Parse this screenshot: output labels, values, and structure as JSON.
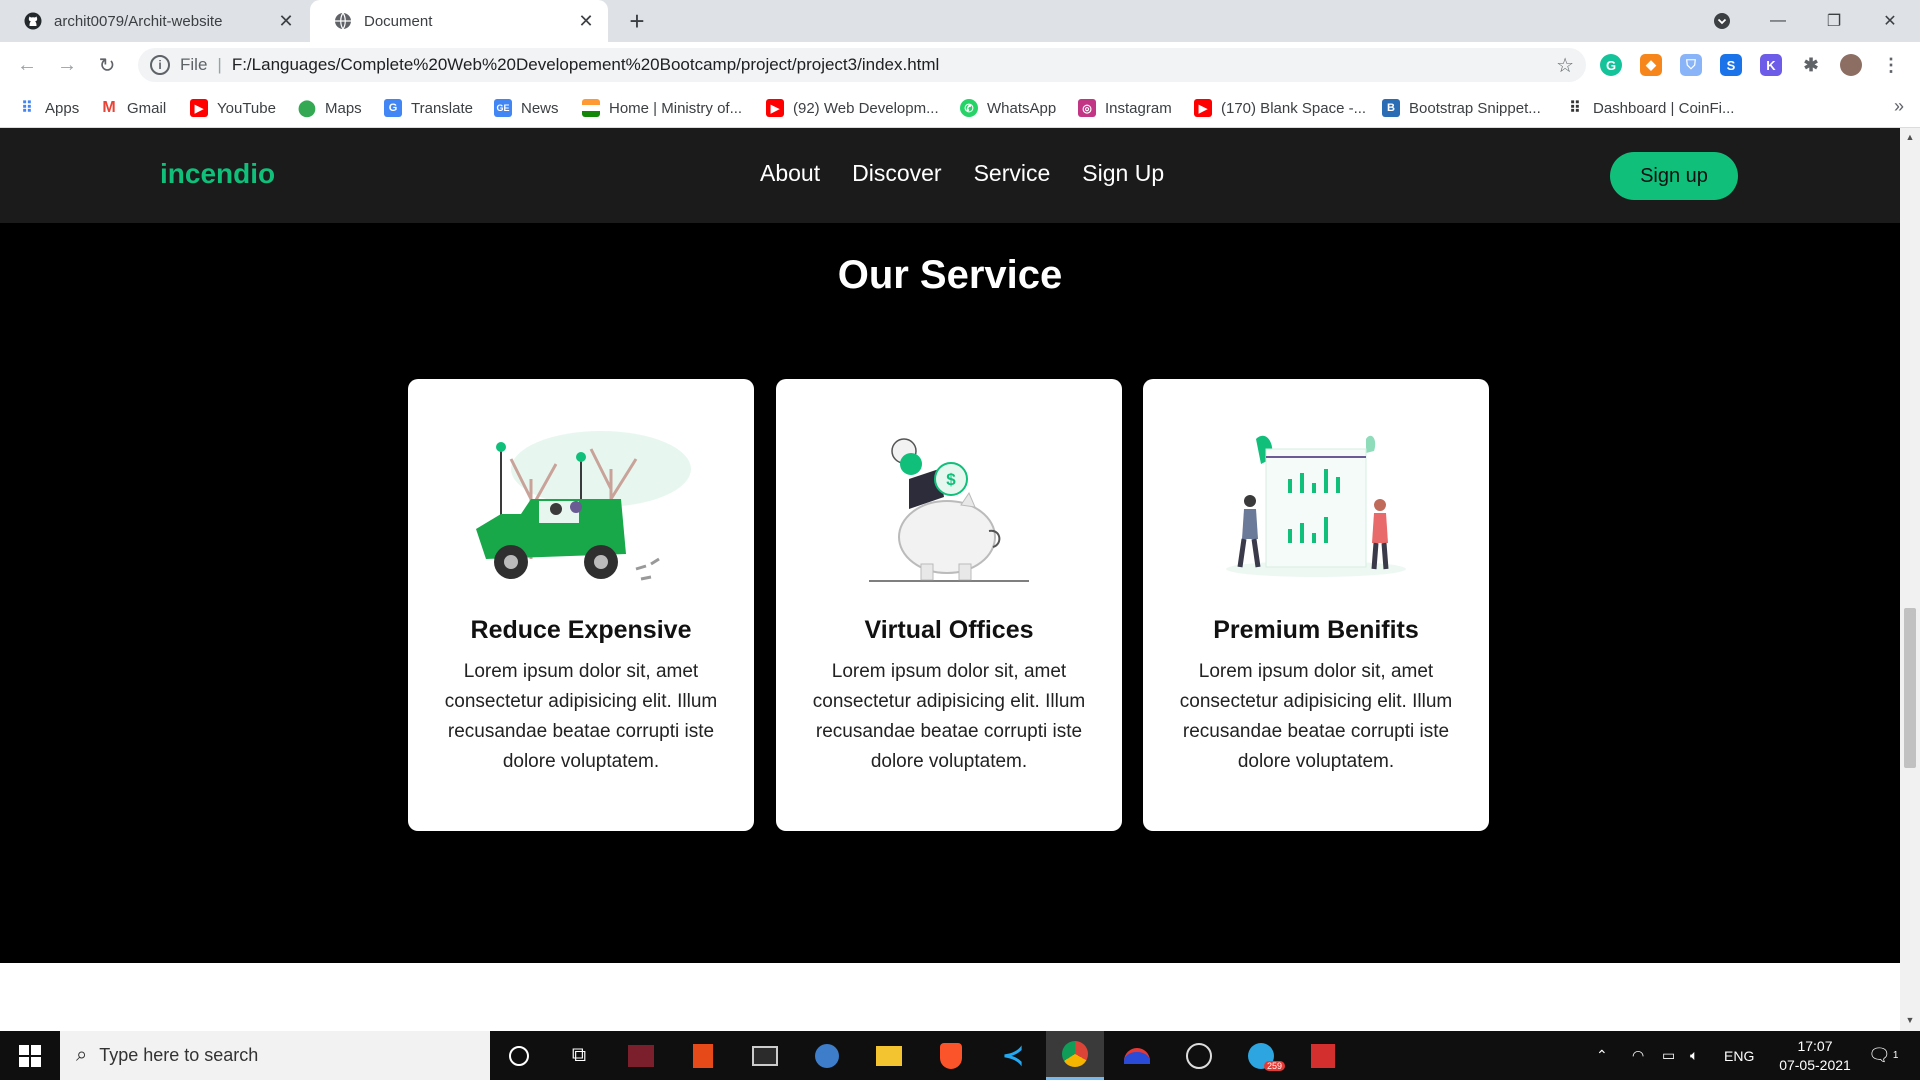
{
  "browser": {
    "tabs": [
      {
        "title": "archit0079/Archit-website",
        "icon": "github-icon"
      },
      {
        "title": "Document",
        "icon": "globe-icon"
      }
    ],
    "url_scheme": "File",
    "url": "F:/Languages/Complete%20Web%20Developement%20Bootcamp/project/project3/index.html"
  },
  "bookmarks": [
    {
      "label": "Apps",
      "icon": "apps-grid-icon",
      "color": "#4285f4"
    },
    {
      "label": "Gmail",
      "icon": "gmail-icon",
      "color": "#ea4335"
    },
    {
      "label": "YouTube",
      "icon": "youtube-icon",
      "color": "#ff0000"
    },
    {
      "label": "Maps",
      "icon": "maps-pin-icon",
      "color": "#34a853"
    },
    {
      "label": "Translate",
      "icon": "translate-icon",
      "color": "#4285f4"
    },
    {
      "label": "News",
      "icon": "news-icon",
      "color": "#4285f4"
    },
    {
      "label": "Home | Ministry of...",
      "icon": "india-flag-icon",
      "color": "#ff9933"
    },
    {
      "label": "(92) Web Developm...",
      "icon": "youtube-icon",
      "color": "#ff0000"
    },
    {
      "label": "WhatsApp",
      "icon": "whatsapp-icon",
      "color": "#25d366"
    },
    {
      "label": "Instagram",
      "icon": "instagram-icon",
      "color": "#c13584"
    },
    {
      "label": "(170) Blank Space -...",
      "icon": "youtube-icon",
      "color": "#ff0000"
    },
    {
      "label": "Bootstrap Snippet...",
      "icon": "bootstrap-icon",
      "color": "#2a6db5"
    },
    {
      "label": "Dashboard | CoinFi...",
      "icon": "coinfi-icon",
      "color": "#333333"
    }
  ],
  "site": {
    "brand": "incendio",
    "nav": [
      "About",
      "Discover",
      "Service",
      "Sign Up"
    ],
    "signup_button": "Sign up",
    "accent": "#0fbf7a",
    "services_heading": "Our Service",
    "cards": [
      {
        "title": "Reduce Expensive",
        "body": "Lorem ipsum dolor sit, amet consectetur adipisicing elit. Illum recusandae beatae corrupti iste dolore voluptatem.",
        "illustration": "green-jeep-illustration"
      },
      {
        "title": "Virtual Offices",
        "body": "Lorem ipsum dolor sit, amet consectetur adipisicing elit. Illum recusandae beatae corrupti iste dolore voluptatem.",
        "illustration": "piggy-bank-illustration"
      },
      {
        "title": "Premium Benifits",
        "body": "Lorem ipsum dolor sit, amet consectetur adipisicing elit. Illum recusandae beatae corrupti iste dolore voluptatem.",
        "illustration": "bar-chart-board-illustration"
      }
    ]
  },
  "taskbar": {
    "search_placeholder": "Type here to search",
    "language": "ENG",
    "time": "17:07",
    "date": "07-05-2021",
    "notification_count": "1",
    "telegram_badge": "259"
  }
}
